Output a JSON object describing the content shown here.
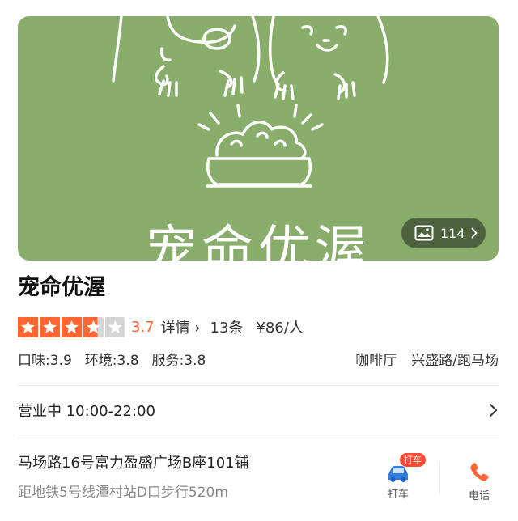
{
  "banner": {
    "title": "宠命优渥",
    "background_color": "#89ad6b",
    "photo_count": "114"
  },
  "shop": {
    "name": "宠命优渥",
    "rating": 3.7,
    "rating_text": "3.7",
    "detail_label": "详情",
    "review_count": "13条",
    "price": "¥86/人",
    "sub_scores": {
      "taste": "口味:3.9",
      "environment": "环境:3.8",
      "service": "服务:3.8"
    },
    "tags": {
      "category": "咖啡厅",
      "area": "兴盛路/跑马场"
    },
    "hours": "营业中 10:00-22:00",
    "address": "马场路16号富力盈盛广场B座101铺",
    "metro": "距地铁5号线潭村站D口步行520m"
  },
  "actions": {
    "taxi_label": "打车",
    "taxi_badge": "打车",
    "call_label": "电话"
  },
  "colors": {
    "accent": "#ff6633",
    "star_gray": "#d6d6d6",
    "badge": "#ff4b33",
    "taxi_icon": "#2f7de1"
  },
  "icons": {
    "photo": "image-icon",
    "chevron": "chevron-right-icon",
    "taxi": "car-icon",
    "call": "phone-icon",
    "star": "star-icon"
  }
}
